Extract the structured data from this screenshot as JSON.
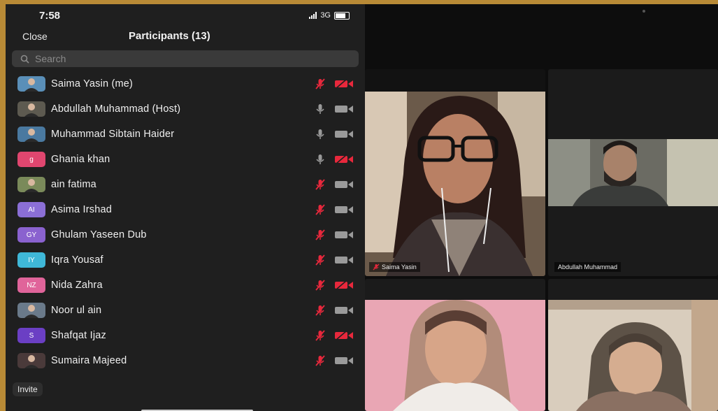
{
  "status_bar": {
    "time": "7:58",
    "network": "3G"
  },
  "header": {
    "close_label": "Close",
    "title": "Participants (13)"
  },
  "search": {
    "placeholder": "Search"
  },
  "participants": [
    {
      "name": "Saima Yasin (me)",
      "avatar": "photo",
      "mic_muted": true,
      "video_off": true
    },
    {
      "name": "Abdullah Muhammad (Host)",
      "avatar": "photo",
      "mic_muted": false,
      "video_off": false
    },
    {
      "name": "Muhammad Sibtain Haider",
      "avatar": "photo",
      "mic_muted": false,
      "video_off": false
    },
    {
      "name": "Ghania khan",
      "avatar_initials": "g",
      "avatar_color": "#e0466f",
      "mic_muted": false,
      "video_off": true
    },
    {
      "name": "ain fatima",
      "avatar": "photo",
      "mic_muted": true,
      "video_off": false
    },
    {
      "name": "Asima Irshad",
      "avatar_initials": "AI",
      "avatar_color": "#8b6fd6",
      "mic_muted": true,
      "video_off": false
    },
    {
      "name": "Ghulam Yaseen Dub",
      "avatar_initials": "GY",
      "avatar_color": "#8a62cf",
      "mic_muted": true,
      "video_off": false
    },
    {
      "name": "Iqra Yousaf",
      "avatar_initials": "IY",
      "avatar_color": "#3fb8d8",
      "mic_muted": true,
      "video_off": false
    },
    {
      "name": "Nida Zahra",
      "avatar_initials": "NZ",
      "avatar_color": "#e0649a",
      "mic_muted": true,
      "video_off": true
    },
    {
      "name": "Noor ul ain",
      "avatar": "photo",
      "mic_muted": true,
      "video_off": false
    },
    {
      "name": "Shafqat Ijaz",
      "avatar_initials": "S",
      "avatar_color": "#6b3fc4",
      "mic_muted": true,
      "video_off": true
    },
    {
      "name": "Sumaira Majeed",
      "avatar": "photo",
      "mic_muted": true,
      "video_off": false
    }
  ],
  "footer": {
    "invite_label": "Invite"
  },
  "video_tiles": [
    {
      "label": "Saima Yasin",
      "mic_muted": true
    },
    {
      "label": "Abdullah Muhammad",
      "mic_muted": false
    },
    {
      "label": "",
      "mic_muted": false
    },
    {
      "label": "",
      "mic_muted": false
    }
  ],
  "colors": {
    "muted_red": "#e8283c",
    "panel_bg": "#1f1f1f",
    "icon_gray": "#9a9a9a"
  }
}
